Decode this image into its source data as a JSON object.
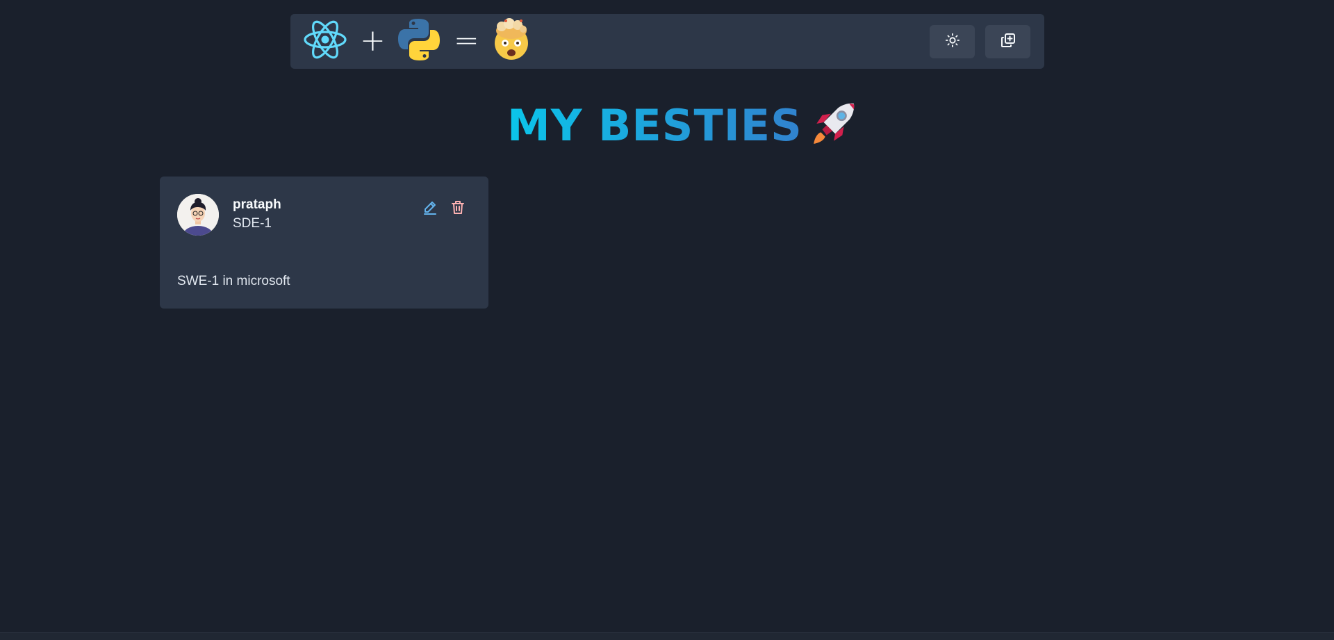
{
  "header": {
    "plus": "+",
    "equals": "=",
    "logos": [
      "react-icon",
      "python-icon",
      "exploding-head-icon"
    ],
    "buttons": [
      "sun-icon",
      "add-copy-icon"
    ]
  },
  "page": {
    "title": "MY BESTIES",
    "title_emoji": "rocket-icon",
    "title_gradient": [
      "#0bc5ea",
      "#3182ce"
    ]
  },
  "friends": [
    {
      "name": "prataph",
      "role": "SDE-1",
      "description": "SWE-1 in microsoft"
    }
  ],
  "colors": {
    "background": "#1a202c",
    "surface": "#2d3748",
    "edit": "#63b3ed",
    "delete": "#feb2b2"
  }
}
